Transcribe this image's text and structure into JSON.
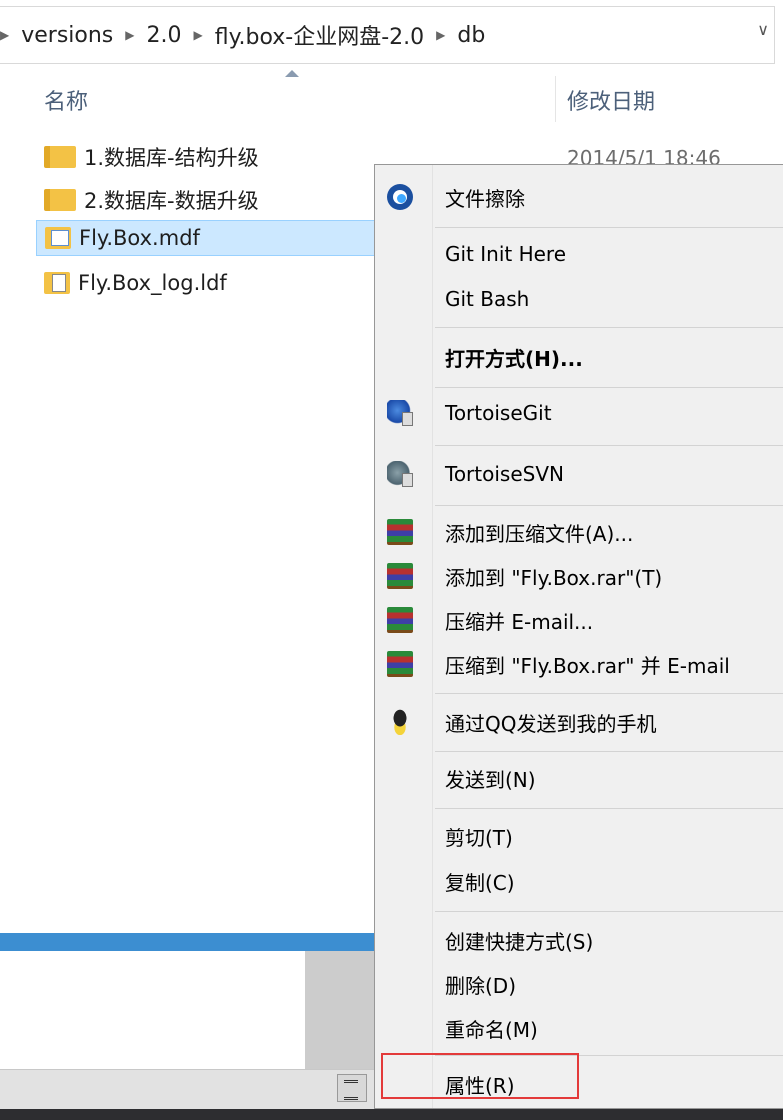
{
  "address": {
    "crumbs": [
      "versions",
      "2.0",
      "fly.box-企业网盘-2.0",
      "db"
    ],
    "dropdown_icon": "chevron-down-icon"
  },
  "columns": {
    "name": "名称",
    "date": "修改日期"
  },
  "files": [
    {
      "name": "1.数据库-结构升级",
      "icon": "folder-icon",
      "date": "2014/5/1 18:46"
    },
    {
      "name": "2.数据库-数据升级",
      "icon": "folder-icon"
    },
    {
      "name": "Fly.Box.mdf",
      "icon": "mdf-file-icon",
      "selected": true
    },
    {
      "name": "Fly.Box_log.ldf",
      "icon": "ldf-file-icon"
    }
  ],
  "context_menu": {
    "items": [
      {
        "label": "文件擦除",
        "icon": "file-erase-icon"
      },
      {
        "label": "Git Init Here"
      },
      {
        "label": "Git Bash"
      },
      {
        "label": "打开方式(H)...",
        "bold": true
      },
      {
        "label": "TortoiseGit",
        "icon": "tortoisegit-icon"
      },
      {
        "label": "TortoiseSVN",
        "icon": "tortoisesvn-icon"
      },
      {
        "label": "添加到压缩文件(A)...",
        "icon": "winrar-icon"
      },
      {
        "label": "添加到 \"Fly.Box.rar\"(T)",
        "icon": "winrar-icon"
      },
      {
        "label": "压缩并 E-mail...",
        "icon": "winrar-icon"
      },
      {
        "label": "压缩到 \"Fly.Box.rar\" 并 E-mail",
        "icon": "winrar-icon"
      },
      {
        "label": "通过QQ发送到我的手机",
        "icon": "qq-penguin-icon"
      },
      {
        "label": "发送到(N)"
      },
      {
        "label": "剪切(T)"
      },
      {
        "label": "复制(C)"
      },
      {
        "label": "创建快捷方式(S)"
      },
      {
        "label": "删除(D)"
      },
      {
        "label": "重命名(M)"
      },
      {
        "label": "属性(R)",
        "highlighted": true
      }
    ]
  },
  "colors": {
    "selection": "#cce8ff",
    "highlight_box": "#e33a3a",
    "accent_bar": "#3c8ed1"
  }
}
